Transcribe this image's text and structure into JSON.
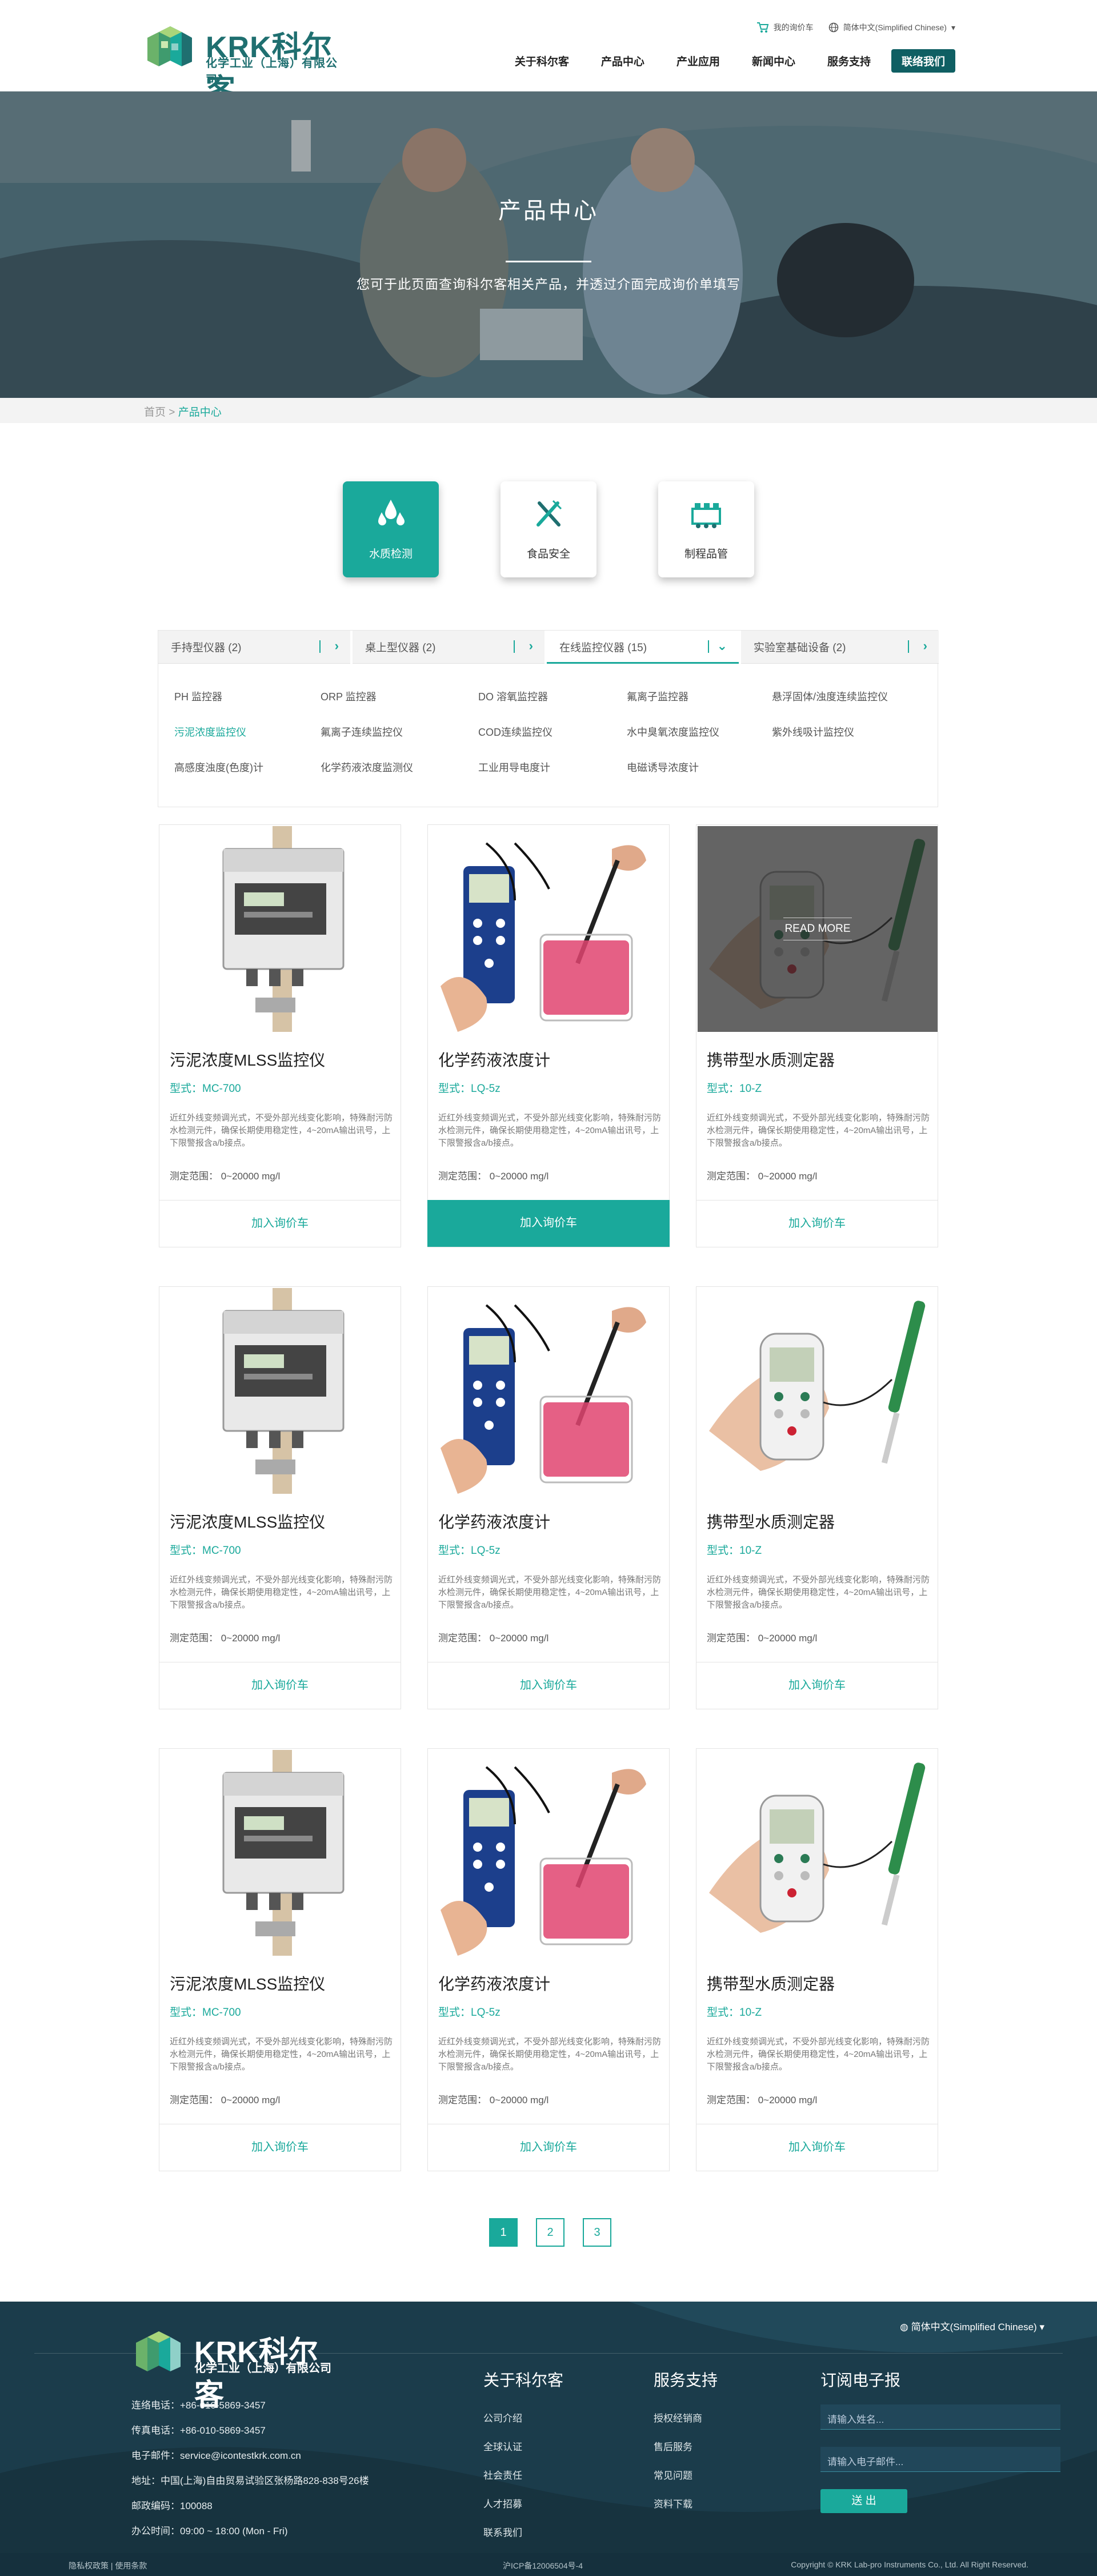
{
  "header": {
    "logo_text": "KRK科尔客",
    "logo_sub": "化学工业（上海）有限公司",
    "cart_label": "我的询价车",
    "language": "简体中文(Simplified Chinese)",
    "nav": [
      "关于科尔客",
      "产品中心",
      "产业应用",
      "新闻中心",
      "服务支持"
    ],
    "contact_label": "联络我们"
  },
  "banner": {
    "title": "产品中心",
    "subtitle": "您可于此页面查询科尔客相关产品，并透过介面完成询价单填写"
  },
  "breadcrumb": {
    "home": "首页",
    "sep": ">",
    "current": "产品中心"
  },
  "categories": [
    {
      "label": "水质检测",
      "icon": "water-drops-icon"
    },
    {
      "label": "食品安全",
      "icon": "fork-knife-icon"
    },
    {
      "label": "制程品管",
      "icon": "factory-icon"
    }
  ],
  "filter": {
    "tabs": [
      "手持型仪器 (2)",
      "桌上型仪器 (2)",
      "在线监控仪器 (15)",
      "实验室基础设备 (2)"
    ],
    "items": [
      [
        "PH 监控器",
        "ORP 监控器",
        "DO 溶氧监控器",
        "氟离子监控器",
        "悬浮固体/浊度连续监控仪"
      ],
      [
        "污泥浓度监控仪",
        "氟离子连续监控仪",
        "COD连续监控仪",
        "水中臭氧浓度监控仪",
        "紫外线吸计监控仪"
      ],
      [
        "高感度浊度(色度)计",
        "化学药液浓度监测仪",
        "工业用导电度计",
        "电磁诱导浓度计"
      ]
    ]
  },
  "products": [
    {
      "name": "污泥浓度MLSS监控仪",
      "model": "型式：MC-700"
    },
    {
      "name": "化学药液浓度计",
      "model": "型式：LQ-5z"
    },
    {
      "name": "携带型水质测定器",
      "model": "型式：10-Z"
    }
  ],
  "product_desc": "近红外线变频调光式，不受外部光线变化影响，特殊耐污防水检测元件，确保长期使用稳定性，4~20mA输出讯号，上下限警报含a/b接点。",
  "product_range": "测定范围： 0~20000 mg/l",
  "add_label": "加入询价车",
  "read_more": "READ MORE",
  "pages": [
    "1",
    "2",
    "3"
  ],
  "footer": {
    "logo_text": "KRK科尔客",
    "logo_sub": "化学工业（上海）有限公司",
    "language": "简体中文(Simplified Chinese)",
    "contact": [
      "连络电话：+86-010-5869-3457",
      "传真电话：+86-010-5869-3457",
      "电子邮件：service@icontestkrk.com.cn",
      "地址：中国(上海)自由贸易试验区张杨路828-838号26楼",
      "邮政编码：100088",
      "办公时间：09:00 ~ 18:00 (Mon - Fri)"
    ],
    "col1_title": "关于科尔客",
    "col1": [
      "公司介绍",
      "全球认证",
      "社会责任",
      "人才招募",
      "联系我们"
    ],
    "col2_title": "服务支持",
    "col2": [
      "授权经销商",
      "售后服务",
      "常见问题",
      "资料下载"
    ],
    "col3_title": "订阅电子报",
    "name_placeholder": "请输入姓名...",
    "email_placeholder": "请输入电子邮件...",
    "submit_label": "送 出",
    "bottom_left": "隐私权政策 | 使用条款",
    "bottom_center": "沪ICP备12006504号-4",
    "bottom_right": "Copyright © KRK Lab-pro Instruments Co., Ltd. All Right Reserved."
  },
  "colors": {
    "accent": "#1aa99b",
    "dark": "#0f5f63",
    "footer": "#1a3b4a"
  }
}
